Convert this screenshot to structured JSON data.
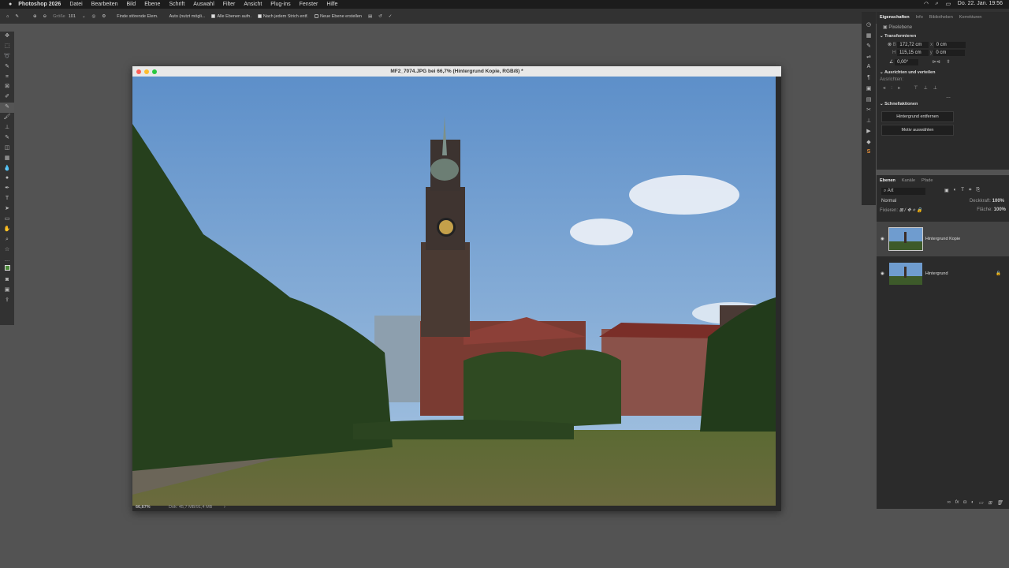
{
  "menubar": {
    "app": "Photoshop 2026",
    "items": [
      "Datei",
      "Bearbeiten",
      "Bild",
      "Ebene",
      "Schrift",
      "Auswahl",
      "Filter",
      "Ansicht",
      "Plug-ins",
      "Fenster",
      "Hilfe"
    ],
    "datetime": "Do. 22. Jan. 19:56"
  },
  "options": {
    "size_label": "Größe",
    "size_value": "101",
    "mode": "Finde störende Elem.",
    "auto": "Auto (nutzt mögli...",
    "all_layers": "Alle Ebenen aufn.",
    "after_stroke": "Nach jedem Strich entf.",
    "new_layer": "Neue Ebene erstellen"
  },
  "document": {
    "title": "MF2_7074.JPG bei 66,7% (Hintergrund Kopie, RGB/8) *",
    "zoom": "66,67%",
    "doc_info": "Dok: 45,7 MB/91,4 MB"
  },
  "properties": {
    "tabs": [
      "Eigenschaften",
      "Info",
      "Bibliotheken",
      "Korrekturen"
    ],
    "layer_type": "Pixelebene",
    "transform_title": "Transformieren",
    "w_label": "B",
    "w": "172,72 cm",
    "h_label": "H",
    "h": "115,15 cm",
    "x_label": "x",
    "x": "0 cm",
    "y_label": "y",
    "y": "0 cm",
    "angle": "0,00°",
    "align_title": "Ausrichten und verteilen",
    "align_label": "Ausrichten:",
    "quick_title": "Schnellaktionen",
    "remove_bg": "Hintergrund entfernen",
    "select_subject": "Motiv auswählen"
  },
  "layers": {
    "tabs": [
      "Ebenen",
      "Kanäle",
      "Pfade"
    ],
    "filter": "Art",
    "blend": "Normal",
    "opacity_label": "Deckkraft:",
    "opacity": "100%",
    "lock_label": "Fixieren:",
    "fill_label": "Fläche:",
    "fill": "100%",
    "items": [
      {
        "name": "Hintergrund Kopie"
      },
      {
        "name": "Hintergrund"
      }
    ]
  }
}
